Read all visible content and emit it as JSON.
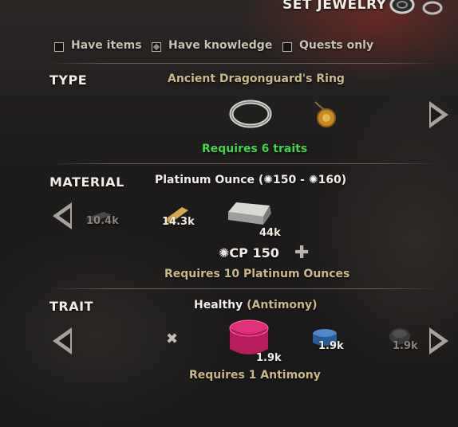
{
  "header": {
    "title": "SET JEWELRY"
  },
  "filters": [
    {
      "label": "Have items",
      "checked": false
    },
    {
      "label": "Have knowledge",
      "checked": true
    },
    {
      "label": "Quests only",
      "checked": false
    }
  ],
  "type_section": {
    "label": "TYPE",
    "selected_name": "Ancient Dragonguard's Ring",
    "items": [
      {
        "icon": "ring-icon"
      },
      {
        "icon": "necklace-icon"
      }
    ],
    "requirement": "Requires 6 traits"
  },
  "material_section": {
    "label": "MATERIAL",
    "selected_name": "Platinum Ounce (",
    "level_min": "150",
    "level_sep": " - ",
    "level_max": "160",
    "level_close": ")",
    "items": [
      {
        "icon": "grain-ingot-icon",
        "count": "10.4k",
        "dim": true
      },
      {
        "icon": "gold-ingot-icon",
        "count": "14.3k",
        "dim": false
      },
      {
        "icon": "platinum-ingot-icon",
        "count": "44k",
        "dim": false
      }
    ],
    "cp_label": "CP 150",
    "plus_symbol": "✚",
    "requirement": "Requires 10 Platinum Ounces"
  },
  "trait_section": {
    "label": "TRAIT",
    "selected_name": "Healthy",
    "selected_sub": "(Antimony)",
    "none_symbol": "✖",
    "items": [
      {
        "icon": "antimony-gem-icon",
        "count": "1.9k"
      },
      {
        "icon": "cobalt-gem-icon",
        "count": "1.9k"
      },
      {
        "icon": "dark-gem-icon",
        "count": "1.9k"
      }
    ],
    "requirement": "Requires 1 Antimony"
  },
  "colors": {
    "requirement_green": "#3fd84a",
    "gold_text": "#cdb98b",
    "header_red": "#8c2a22"
  }
}
